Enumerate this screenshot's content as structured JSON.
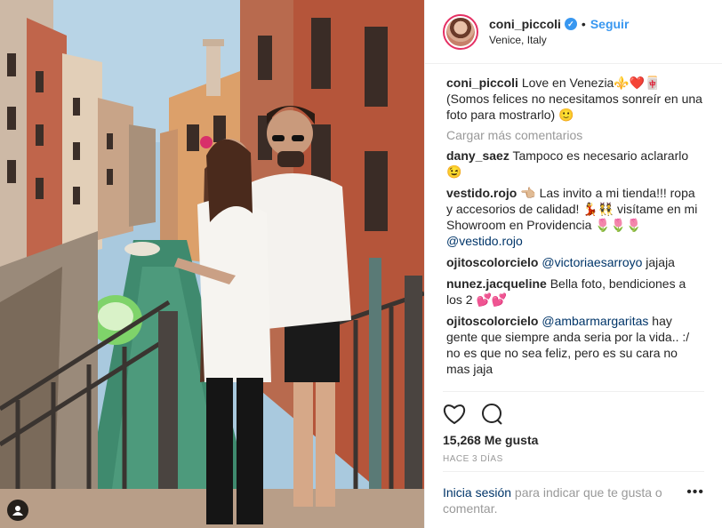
{
  "header": {
    "username": "coni_piccoli",
    "separator": "•",
    "follow_label": "Seguir",
    "location": "Venice, Italy"
  },
  "caption": {
    "user": "coni_piccoli",
    "text": "Love en Venezia⚜️❤️🀄 (Somos felices no necesitamos sonreír en una foto para mostrarlo) 🙂"
  },
  "load_more": "Cargar más comentarios",
  "comments": [
    {
      "user": "dany_saez",
      "pre": "Tampoco es necesario aclararlo 😉",
      "mention": "",
      "post": ""
    },
    {
      "user": "vestido.rojo",
      "pre": "👈🏼 Las invito a mi tienda!!! ropa y accesorios de calidad! 💃👯 visítame en mi Showroom en Providencia 🌷🌷🌷 ",
      "mention": "@vestido.rojo",
      "post": ""
    },
    {
      "user": "ojitoscolorcielo",
      "pre": "",
      "mention": "@victoriaesarroyo",
      "post": " jajaja"
    },
    {
      "user": "nunez.jacqueline",
      "pre": "Bella foto, bendiciones a los 2 💕💕",
      "mention": "",
      "post": ""
    },
    {
      "user": "ojitoscolorcielo",
      "pre": "",
      "mention": "@ambarmargaritas",
      "post": " hay gente que siempre anda seria por la vida.. :/ no es que no sea feliz, pero es su cara no mas jaja"
    }
  ],
  "actions": {
    "like_icon": "heart-outline",
    "comment_icon": "speech-bubble-outline"
  },
  "likes": "15,268 Me gusta",
  "time": "HACE 3 DÍAS",
  "login": {
    "link": "Inicia sesión",
    "rest": " para indicar que te gusta o comentar."
  },
  "more": "•••",
  "colors": {
    "accent": "#3897f0",
    "mention": "#003569",
    "muted": "#999999"
  }
}
